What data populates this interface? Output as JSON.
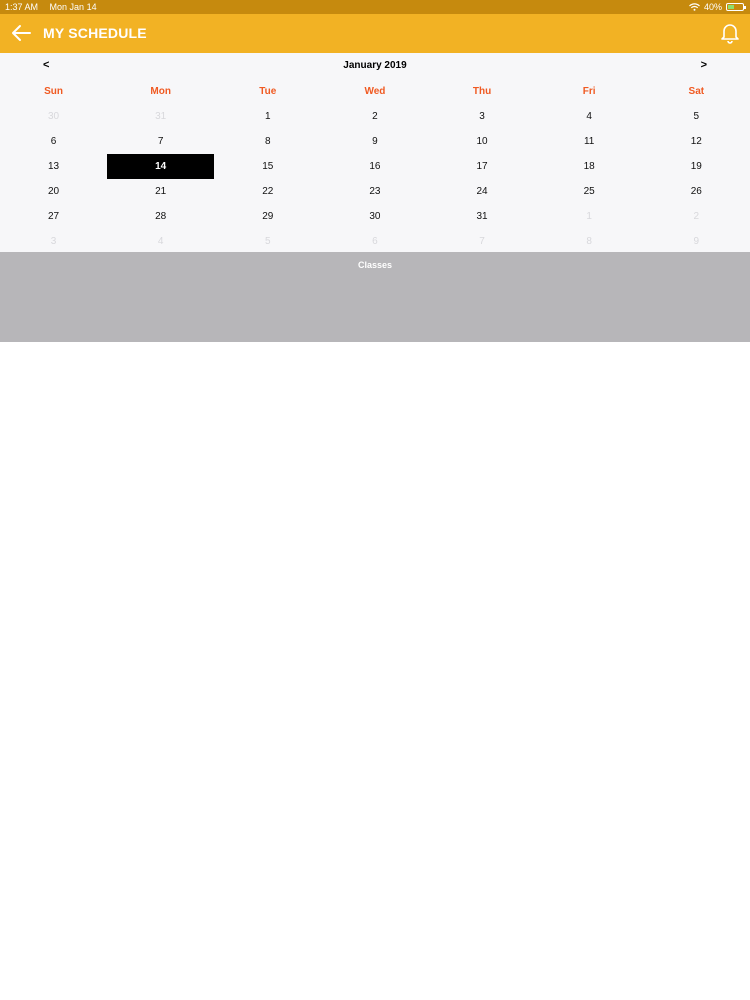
{
  "status_bar": {
    "time": "1:37 AM",
    "date": "Mon Jan 14",
    "battery": "40%"
  },
  "header": {
    "title": "MY SCHEDULE",
    "back_icon": "arrow-left-icon",
    "notification_icon": "bell-icon"
  },
  "calendar": {
    "month_label": "January 2019",
    "prev_label": "<",
    "next_label": ">",
    "weekdays": [
      "Sun",
      "Mon",
      "Tue",
      "Wed",
      "Thu",
      "Fri",
      "Sat"
    ],
    "weeks": [
      [
        "30",
        "31",
        "1",
        "2",
        "3",
        "4",
        "5"
      ],
      [
        "6",
        "7",
        "8",
        "9",
        "10",
        "11",
        "12"
      ],
      [
        "13",
        "14",
        "15",
        "16",
        "17",
        "18",
        "19"
      ],
      [
        "20",
        "21",
        "22",
        "23",
        "24",
        "25",
        "26"
      ],
      [
        "27",
        "28",
        "29",
        "30",
        "31",
        "1",
        "2"
      ],
      [
        "3",
        "4",
        "5",
        "6",
        "7",
        "8",
        "9"
      ]
    ],
    "selected_day": "14",
    "colors": {
      "weekday": "#f05a22",
      "header": "#f2b224",
      "selected": "#000000"
    }
  },
  "classes": {
    "label": "Classes"
  }
}
